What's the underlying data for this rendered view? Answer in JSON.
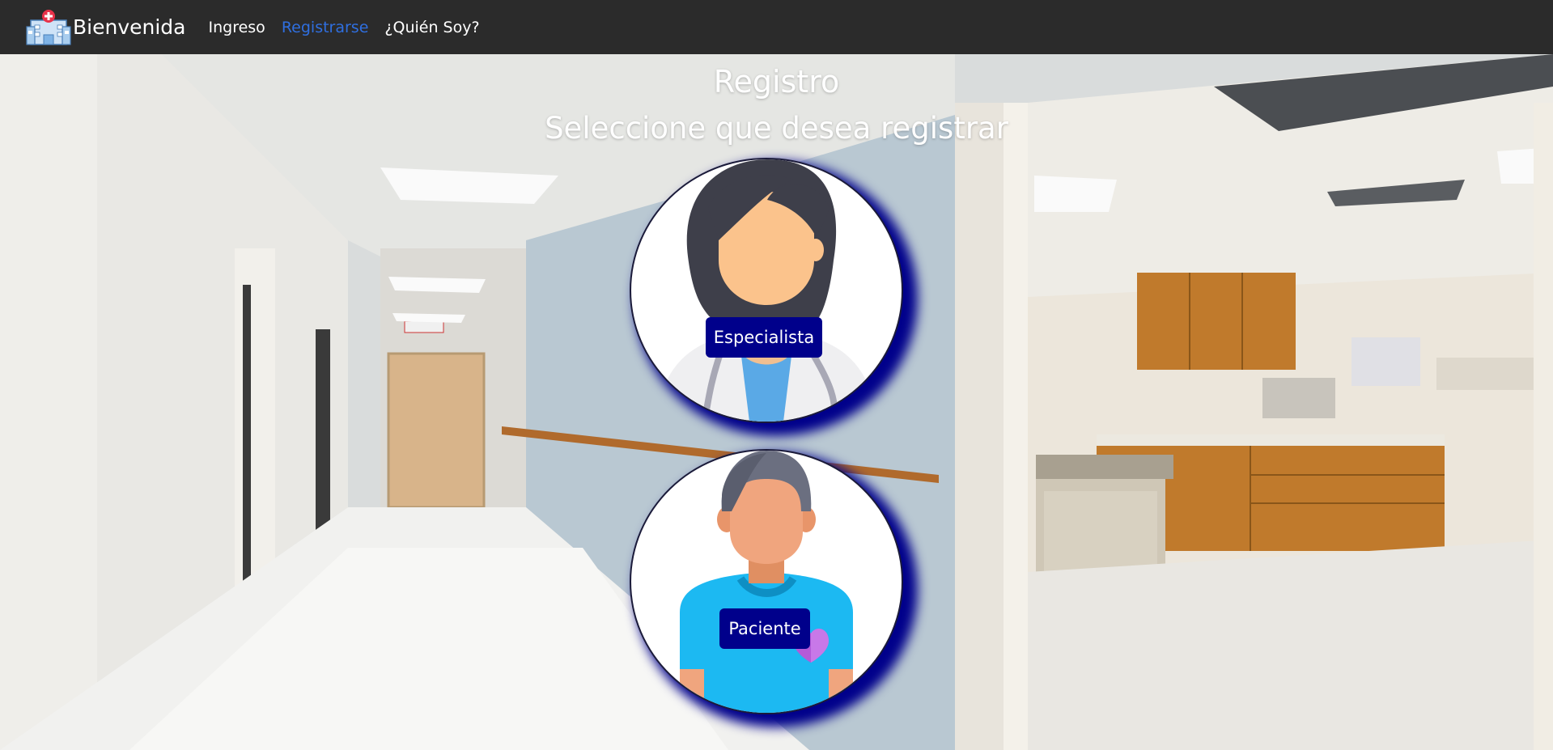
{
  "navbar": {
    "brand": {
      "icon": "hospital-icon",
      "label": "Bienvenida"
    },
    "links": [
      {
        "label": "Ingreso",
        "active": false
      },
      {
        "label": "Registrarse",
        "active": true
      },
      {
        "label": "¿Quién Soy?",
        "active": false
      }
    ]
  },
  "main": {
    "title": "Registro",
    "subtitle": "Seleccione que desea registrar",
    "options": [
      {
        "label": "Especialista",
        "icon": "doctor-avatar-icon"
      },
      {
        "label": "Paciente",
        "icon": "patient-avatar-icon"
      }
    ],
    "background": "hospital-hallway-image"
  },
  "colors": {
    "navbar_bg": "#2b2b2b",
    "active_link": "#2f6fe0",
    "button_bg": "#00008b",
    "card_shadow": "#00008b"
  }
}
